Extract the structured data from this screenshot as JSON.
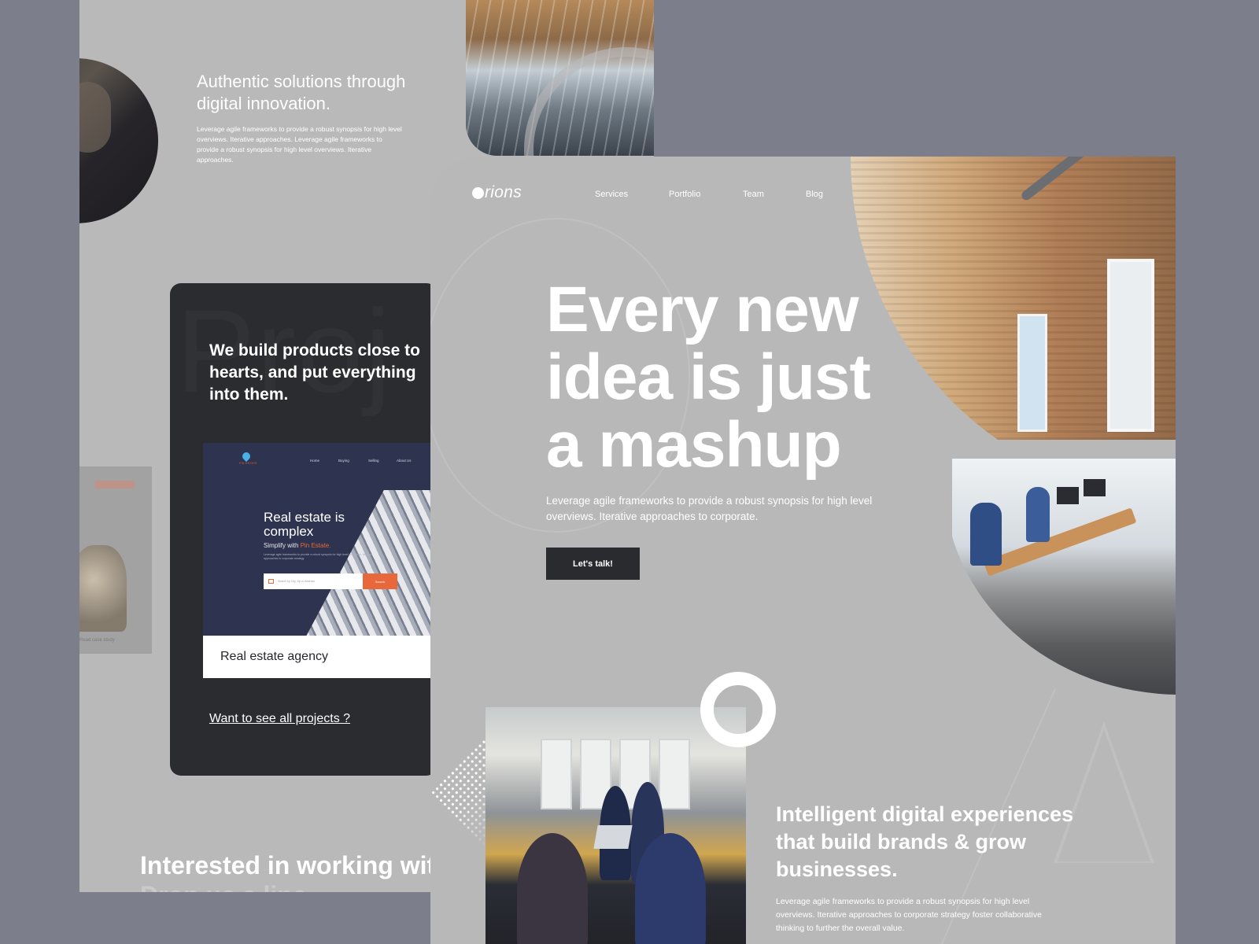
{
  "back_page": {
    "heading": "Authentic solutions through digital innovation.",
    "paragraph": "Leverage agile frameworks to provide a robust synopsis for high level overviews. Iterative approaches. Leverage agile frameworks to provide a robust synopsis for high level overviews. Iterative approaches.",
    "project_section": {
      "watermark": "Proj",
      "heading": "We build products close to hearts, and put everything into them.",
      "preview": {
        "logo_text": "PIN ESTATE",
        "nav": [
          "Home",
          "Buying",
          "Selling",
          "About Us"
        ],
        "title": "Real estate is complex",
        "subtitle_prefix": "Simplify with ",
        "subtitle_accent": "Pin Estate.",
        "description": "Leverage agile frameworks to provide a robust synopsis for high level overviews. Iterative approaches to corporate strategy.",
        "search_placeholder": "Search by City, Zip or Address",
        "search_button": "Search",
        "accent_color": "#e8673b"
      },
      "caption": "Real estate agency",
      "link": "Want to see all projects ?"
    },
    "side_thumb_text": "Read case study",
    "footer": "Interested in working with us?",
    "footer_ghost": "Drop us a line"
  },
  "front_page": {
    "logo": "rions",
    "nav": [
      "Services",
      "Portfolio",
      "Team",
      "Blog"
    ],
    "hero": {
      "heading": "Every new idea is just a mashup",
      "paragraph": "Leverage agile frameworks to provide a robust synopsis for high level overviews. Iterative approaches to corporate.",
      "cta": "Let's talk!"
    },
    "section2": {
      "heading": "Intelligent digital experiences that build brands & grow businesses.",
      "paragraph": "Leverage agile frameworks to provide a robust synopsis for high level overviews. Iterative approaches to corporate strategy foster collaborative thinking to further the overall value."
    }
  },
  "colors": {
    "background": "#7d7e8b",
    "page": "#b8b8b9",
    "dark_card": "#2b2c30",
    "button": "#2a2b2f",
    "accent": "#e8673b"
  }
}
